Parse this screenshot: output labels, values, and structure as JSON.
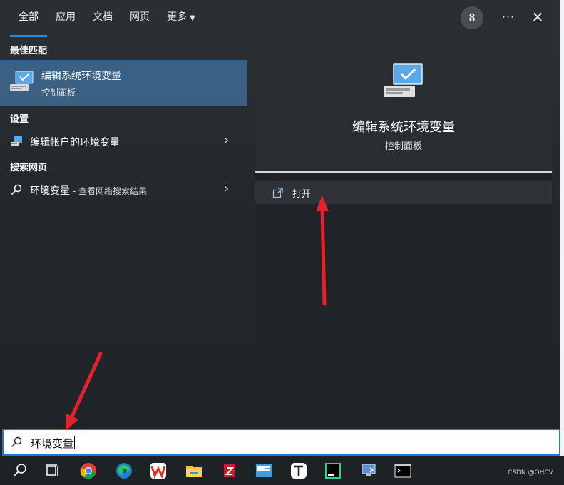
{
  "tabs": [
    {
      "label": "全部",
      "active": true
    },
    {
      "label": "应用"
    },
    {
      "label": "文档"
    },
    {
      "label": "网页"
    },
    {
      "label": "更多"
    }
  ],
  "header": {
    "badge_count": "8",
    "more_label": "···",
    "close_label": "✕"
  },
  "sections": {
    "best_match": "最佳匹配",
    "settings": "设置",
    "web_search": "搜索网页"
  },
  "best_match": {
    "name": "编辑系统环境变量",
    "subtitle": "控制面板",
    "icon": "monitor-check-icon"
  },
  "settings_item": {
    "label": "编辑帐户的环境变量",
    "icon": "settings-monitor-icon"
  },
  "web_item": {
    "label": "环境变量",
    "suffix": " - 查看网络搜索结果",
    "icon": "search-icon"
  },
  "preview": {
    "title": "编辑系统环境变量",
    "subtitle": "控制面板",
    "open_label": "打开"
  },
  "search": {
    "value": "环境变量"
  },
  "taskbar": {
    "icons": [
      "search-icon",
      "task-view-icon",
      "chrome-icon",
      "edge-icon",
      "wps-icon",
      "file-explorer-icon",
      "red-app-icon",
      "image-app-icon",
      "typora-icon",
      "pycharm-icon",
      "remote-desktop-icon",
      "terminal-icon"
    ]
  },
  "watermark": "CSDN @QHCV",
  "colors": {
    "accent": "#1e90e0",
    "selection": "#3a6184",
    "arrow": "#e5222b"
  }
}
